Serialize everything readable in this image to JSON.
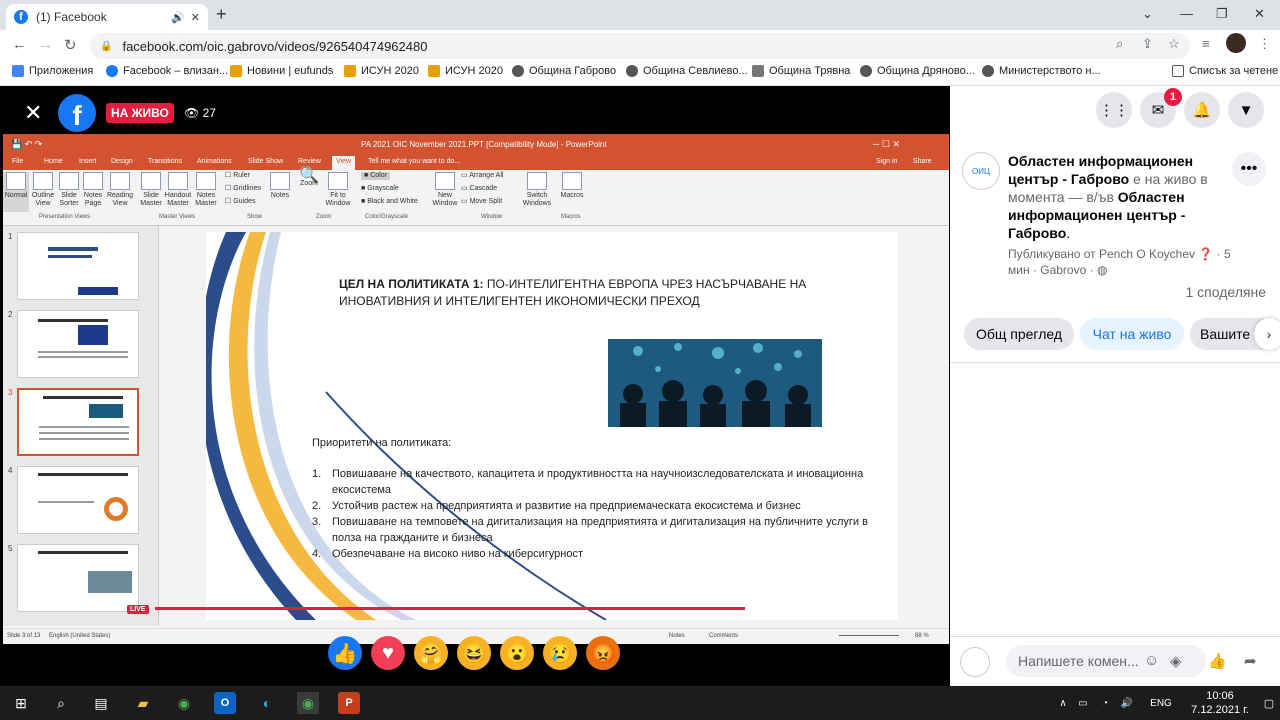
{
  "browser": {
    "tab_title": "(1) Facebook",
    "url": "facebook.com/oic.gabrovo/videos/926540474962480",
    "bookmarks": [
      {
        "label": "Приложения",
        "color": "#4285f4"
      },
      {
        "label": "Facebook – влизан...",
        "color": "#1877f2"
      },
      {
        "label": "Новини | eufunds",
        "color": "#e8a000"
      },
      {
        "label": "ИСУН 2020",
        "color": "#e8a000"
      },
      {
        "label": "ИСУН 2020",
        "color": "#e8a000"
      },
      {
        "label": "Община Габрово",
        "color": "#555"
      },
      {
        "label": "Община Севлиево...",
        "color": "#555"
      },
      {
        "label": "Община Трявна",
        "color": "#777"
      },
      {
        "label": "Община Дряново...",
        "color": "#555"
      },
      {
        "label": "Министерството н...",
        "color": "#555"
      }
    ],
    "reading_list": "Списък за четене"
  },
  "video": {
    "live_label": "НА ЖИВО",
    "viewers": "27",
    "live_tag": "LIVE",
    "progress": 1.0
  },
  "ppt": {
    "window_title": "PA 2021 OIC November 2021.PPT [Compatibility Mode] - PowerPoint",
    "menu": [
      "File",
      "Home",
      "Insert",
      "Design",
      "Transitions",
      "Animations",
      "Slide Show",
      "Review",
      "View"
    ],
    "tell_me": "Tell me what you want to do...",
    "sign_in": "Sign in",
    "share": "Share",
    "ribbon": {
      "normal": "Normal",
      "outline": "Outline View",
      "sorter": "Slide Sorter",
      "notes_page": "Notes Page",
      "reading": "Reading View",
      "slide_master": "Slide Master",
      "handout_master": "Handout Master",
      "notes_master": "Notes Master",
      "ruler": "Ruler",
      "gridlines": "Gridlines",
      "guides": "Guides",
      "notes": "Notes",
      "zoom": "Zoom",
      "fit": "Fit to Window",
      "color": "Color",
      "grayscale": "Grayscale",
      "bw": "Black and White",
      "new_window": "New Window",
      "arrange": "Arrange All",
      "cascade": "Cascade",
      "move_split": "Move Split",
      "switch": "Switch Windows",
      "macros": "Macros",
      "groups": [
        "Presentation Views",
        "Master Views",
        "Show",
        "Zoom",
        "Color/Grayscale",
        "Window",
        "Macros"
      ]
    },
    "thumbnails": [
      "1",
      "2",
      "3",
      "4",
      "5"
    ],
    "slide": {
      "title_bold": "ЦЕЛ НА ПОЛИТИКАТА 1:",
      "title_rest": " ПО-ИНТЕЛИГЕНТНА ЕВРОПА ЧРЕЗ НАСЪРЧАВАНЕ НА ИНОВАТИВНИЯ И ИНТЕЛИГЕНТЕН ИКОНОМИЧЕСКИ ПРЕХОД",
      "priorities_heading": "Приоритети на политиката:",
      "priorities": [
        {
          "n": "1.",
          "text": "Повишаване на качеството, капацитета и продуктивността на научноизследователската и иновационна екосистема"
        },
        {
          "n": "2.",
          "text": "Устойчив растеж на предприятията и развитие на предприемаческата екосистема и бизнес"
        },
        {
          "n": "3.",
          "text": "Повишаване на темповете на дигитализация на предприятията и дигитализация на публичните услуги в полза на гражданите и бизнеса"
        },
        {
          "n": "4.",
          "text": "Обезпечаване на високо ниво на киберсигурност"
        }
      ]
    },
    "status": {
      "slide_of": "Slide 3 of 13",
      "lang": "English (United States)",
      "notes": "Notes",
      "comments": "Comments",
      "zoom": "88 %"
    }
  },
  "panel": {
    "notif_count": "1",
    "page_name": "Областен информационен център - Габрово",
    "live_now": " е на живо в момента — в/ъв ",
    "page_name2": "Областен информационен център - Габрово",
    "published_by": "Публикувано от Pench O Koychev",
    "meta_rest": "· 5 мин · Gabrovo ·",
    "shares": "1 споделяне",
    "tabs": [
      "Общ преглед",
      "Чат на живо",
      "Вашите"
    ],
    "comment_placeholder": "Напишете комен..."
  },
  "taskbar": {
    "lang": "ENG",
    "time": "10:06",
    "date": "7.12.2021 г."
  }
}
